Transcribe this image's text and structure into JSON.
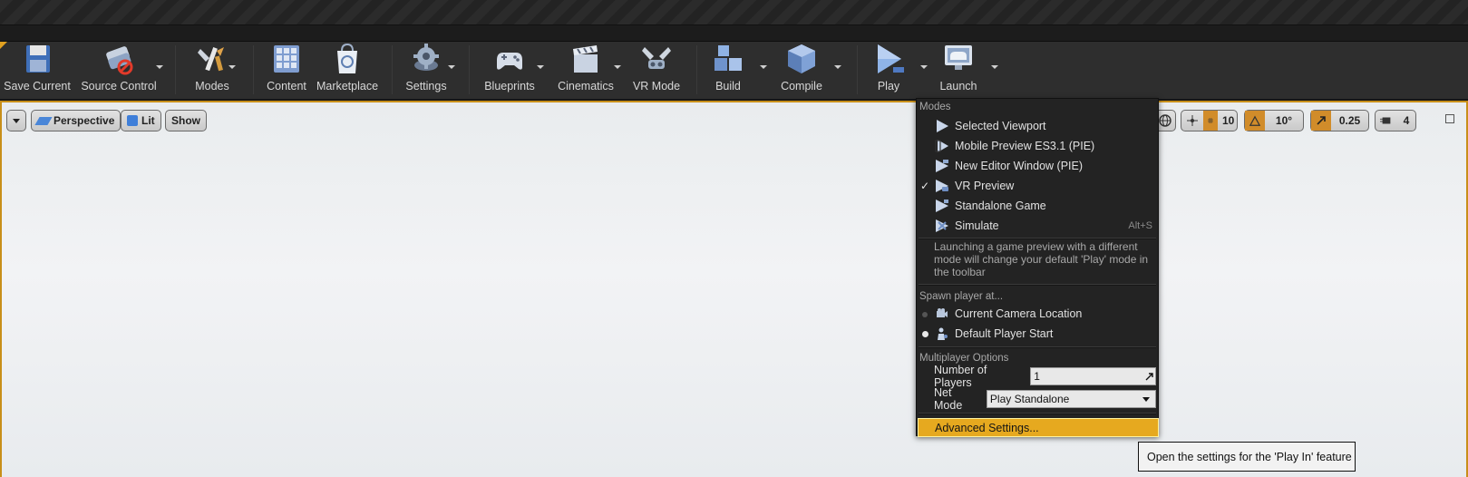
{
  "toolbar": {
    "save_current": "Save Current",
    "source_control": "Source Control",
    "modes": "Modes",
    "content": "Content",
    "marketplace": "Marketplace",
    "settings": "Settings",
    "blueprints": "Blueprints",
    "cinematics": "Cinematics",
    "vr_mode": "VR Mode",
    "build": "Build",
    "compile": "Compile",
    "play": "Play",
    "launch": "Launch"
  },
  "viewport": {
    "perspective": "Perspective",
    "lit": "Lit",
    "show": "Show",
    "grid_snap": "10",
    "rot_snap": "10°",
    "scale_snap": "0.25",
    "cam_speed": "4"
  },
  "play_menu": {
    "modes_header": "Modes",
    "items": [
      {
        "label": "Selected Viewport",
        "shortcut": "",
        "checked": false
      },
      {
        "label": "Mobile Preview ES3.1 (PIE)",
        "shortcut": "",
        "checked": false
      },
      {
        "label": "New Editor Window (PIE)",
        "shortcut": "",
        "checked": false
      },
      {
        "label": "VR Preview",
        "shortcut": "",
        "checked": true
      },
      {
        "label": "Standalone Game",
        "shortcut": "",
        "checked": false
      },
      {
        "label": "Simulate",
        "shortcut": "Alt+S",
        "checked": false
      }
    ],
    "description": "Launching a game preview with a different mode will change your default 'Play' mode in the toolbar",
    "spawn_header": "Spawn player at...",
    "spawn_options": [
      {
        "label": "Current Camera Location",
        "selected": false
      },
      {
        "label": "Default Player Start",
        "selected": true
      }
    ],
    "multiplayer_header": "Multiplayer Options",
    "num_players_label": "Number of Players",
    "num_players_value": "1",
    "net_mode_label": "Net Mode",
    "net_mode_value": "Play Standalone",
    "advanced": "Advanced Settings..."
  },
  "tooltip": "Open the settings for the 'Play In' feature",
  "colors": {
    "accent": "#e6a91f",
    "toolbar_bg": "#2e2e2e",
    "menu_bg": "#232323"
  }
}
